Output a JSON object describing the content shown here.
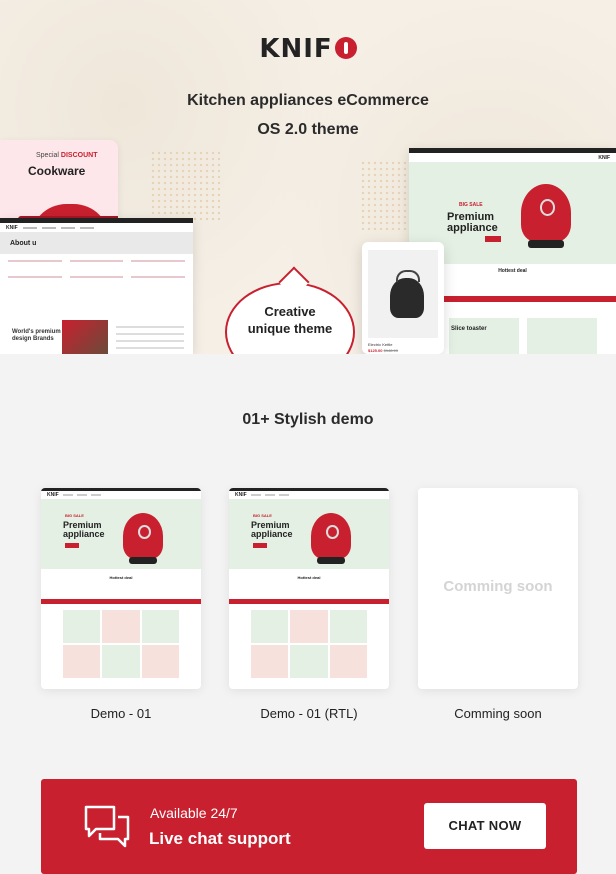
{
  "brand": {
    "name": "KNIF"
  },
  "hero": {
    "tagline_line1": "Kitchen appliances eCommerce",
    "tagline_line2": "OS 2.0 theme",
    "bubble_line1": "Creative",
    "bubble_line2": "unique theme",
    "cookware_card": {
      "tag_prefix": "Special",
      "tag_highlight": "DISCOUNT",
      "title": "Cookware"
    },
    "about_mock": {
      "title": "About u",
      "bottom_line1": "World's premium",
      "bottom_line2": "design Brands"
    },
    "premium_mock": {
      "small": "BIG SALE",
      "title_line1": "Premium",
      "title_line2": "appliance",
      "deal": "Hottest deal",
      "tile": "Slice toaster"
    },
    "product_mock": {
      "name": "Electric Kettle",
      "price": "$125.00",
      "old_price": "$148.00"
    }
  },
  "demos": {
    "heading": "01+ Stylish demo",
    "items": [
      {
        "label": "Demo - 01",
        "hero_line1": "Premium",
        "hero_line2": "appliance",
        "deal": "Hottest deal"
      },
      {
        "label": "Demo  - 01 (RTL)",
        "hero_line1": "Premium",
        "hero_line2": "appliance",
        "deal": "Hottest deal"
      },
      {
        "label": "Comming soon",
        "placeholder": "Comming soon"
      }
    ]
  },
  "support": {
    "small": "Available 24/7",
    "big": "Live chat support",
    "button": "CHAT NOW"
  },
  "colors": {
    "accent": "#c8202f",
    "mint": "#e4f0e3",
    "cream": "#f5efe6",
    "dark": "#222222"
  }
}
